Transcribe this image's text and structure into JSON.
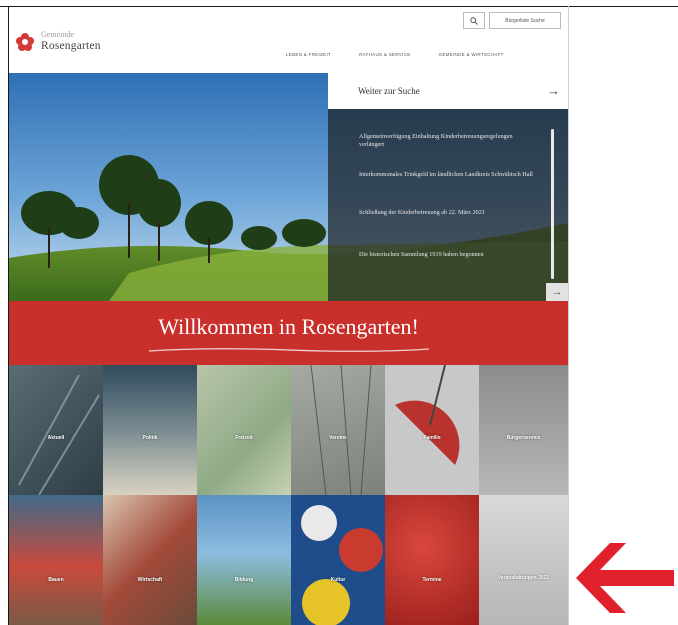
{
  "header": {
    "logo_small": "Gemeinde",
    "logo_big": "Rosengarten",
    "search_icon": "magnifier-icon",
    "citizen_button": "Bürgerliste Suche"
  },
  "nav": {
    "items": [
      "LEBEN & FREIZEIT",
      "RATHAUS & SERVICE",
      "GEMEINDE & WIRTSCHAFT"
    ]
  },
  "news": {
    "title": "Weiter zur Suche",
    "arrow_icon": "arrow-right-icon",
    "items": [
      "Allgemeinverfügung Einhaltung Kinderbetreuungsregelungen verlängert",
      "Interkommunales Trinkgeld im ländlichen Landkreis Schwäbisch Hall",
      "Schließung der Kinderbetreuung ab 22. März 2021",
      "Die historischen Sammlung 1919 haben begonnen"
    ],
    "next_icon": "arrow-right-icon"
  },
  "banner": {
    "title": "Willkommen in Rosengarten!"
  },
  "tiles": {
    "row1": [
      "Aktuell",
      "Politik",
      "Freizeit",
      "Vereine",
      "Familie",
      "Bürgerservice"
    ],
    "row2": [
      "Bauen",
      "Wirtschaft",
      "Bildung",
      "Kultur",
      "Termine",
      "Veranstaltungen 2021"
    ]
  },
  "colors": {
    "brand_red": "#c9302c",
    "arrow_red": "#e0202a",
    "news_bg": "#1e2226"
  }
}
